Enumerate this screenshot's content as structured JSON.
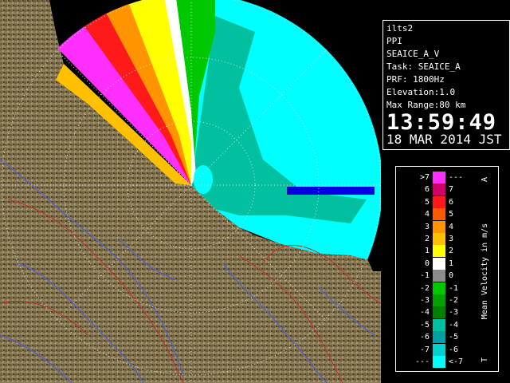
{
  "info": {
    "site": "ilts2",
    "product": "PPI",
    "task_name": "SEAICE_A_V",
    "task": "Task: SEAICE_A",
    "prf": "PRF: 1800Hz",
    "elevation": "Elevation:1.0",
    "max_range": "Max Range:80 km",
    "time": "13:59:49",
    "date": "18 MAR 2014 JST"
  },
  "legend": {
    "title": "Mean Velocity in m/s",
    "top_marker": "A",
    "bottom_marker": "T",
    "rows": [
      {
        "left": ">7",
        "right": "---",
        "color": "#ff30ff"
      },
      {
        "left": "6",
        "right": "7",
        "color": "#d0006a"
      },
      {
        "left": "5",
        "right": "6",
        "color": "#ff1a1a"
      },
      {
        "left": "4",
        "right": "5",
        "color": "#ff5a00"
      },
      {
        "left": "3",
        "right": "4",
        "color": "#ff9400"
      },
      {
        "left": "2",
        "right": "3",
        "color": "#ffc000"
      },
      {
        "left": "1",
        "right": "2",
        "color": "#ffff00"
      },
      {
        "left": "0",
        "right": "1",
        "color": "#ffffff"
      },
      {
        "left": "-1",
        "right": "0",
        "color": "#8c8c8c"
      },
      {
        "left": "-2",
        "right": "-1",
        "color": "#00c800"
      },
      {
        "left": "-3",
        "right": "-2",
        "color": "#00a000"
      },
      {
        "left": "-4",
        "right": "-3",
        "color": "#008000"
      },
      {
        "left": "-5",
        "right": "-4",
        "color": "#00c0a0"
      },
      {
        "left": "-6",
        "right": "-5",
        "color": "#00a0a0"
      },
      {
        "left": "-7",
        "right": "-6",
        "color": "#00d0d0"
      },
      {
        "left": "---",
        "right": "<-7",
        "color": "#00ffff"
      }
    ]
  },
  "colors": {
    "land": "#8a7a55",
    "land_dark": "#5e5238",
    "river": "#5060d0",
    "border": "#c03030",
    "ring": "#d8d8d8"
  }
}
